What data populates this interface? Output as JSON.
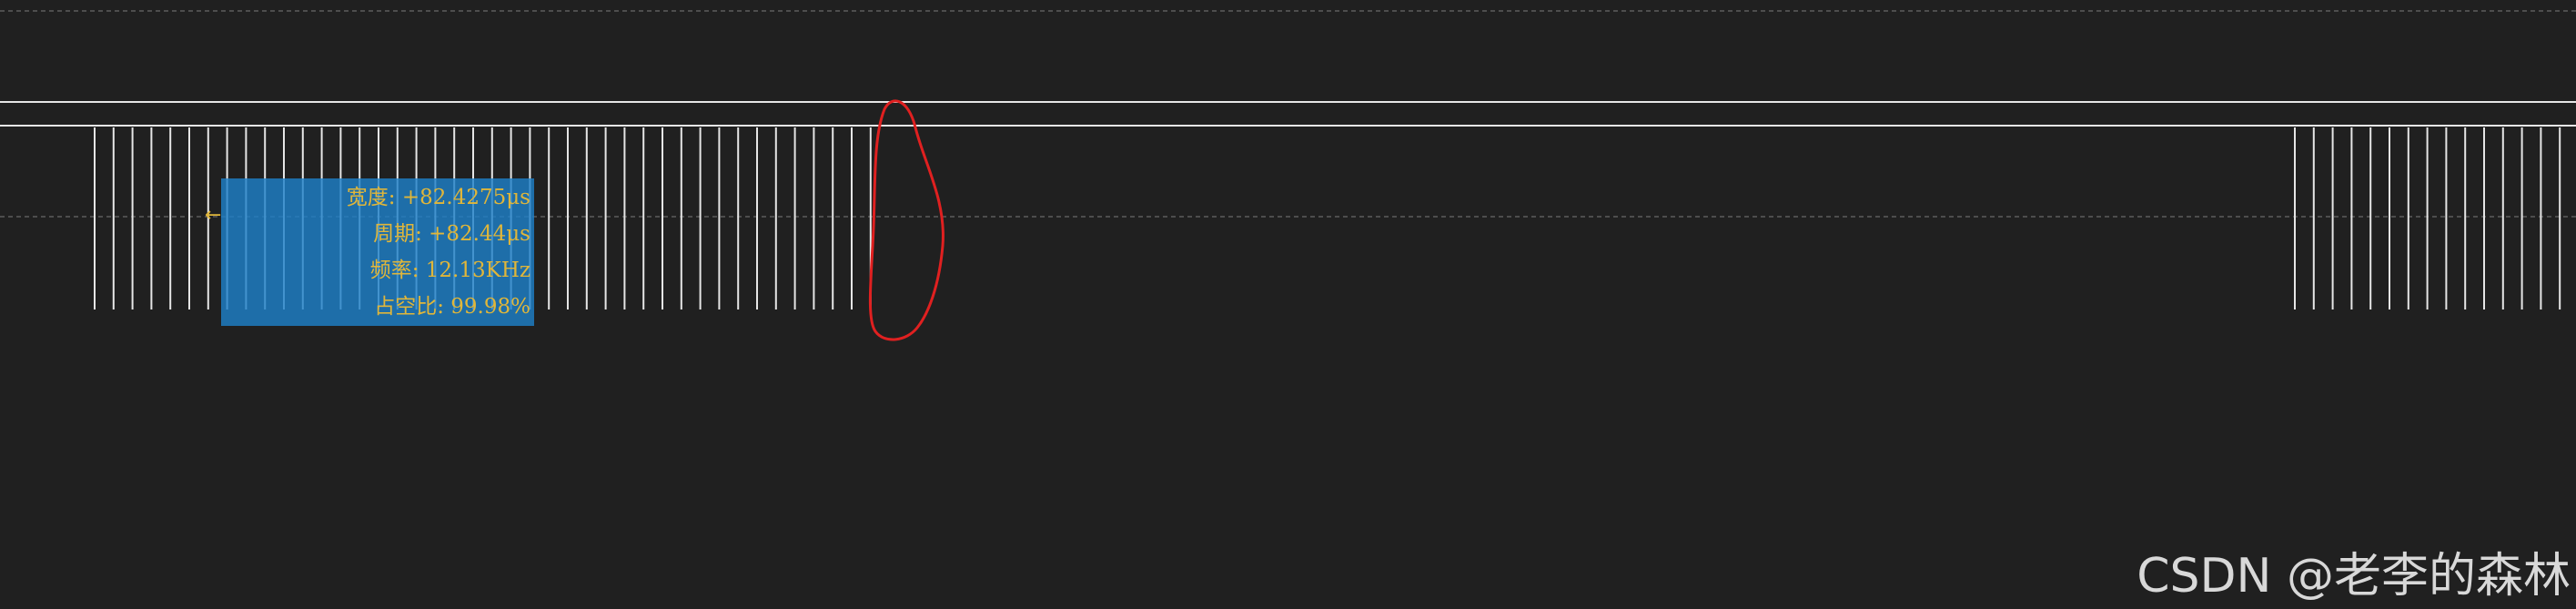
{
  "measurement": {
    "width_label": "宽度: +82.4275μs",
    "period_label": "周期: +82.44μs",
    "frequency_label": "频率: 12.13KHz",
    "duty_label": "占空比: 99.98%"
  },
  "cursor_marker": "←",
  "watermark": "CSDN @老李的森林",
  "colors": {
    "background": "#202020",
    "trace": "#e6e6e6",
    "measure_box": "#1e80c8",
    "measure_text": "#e0b63a",
    "annotation": "#e02020"
  },
  "icons": {
    "cursor_marker": "left-arrow-icon",
    "annotation": "red-hand-drawn-loop"
  }
}
